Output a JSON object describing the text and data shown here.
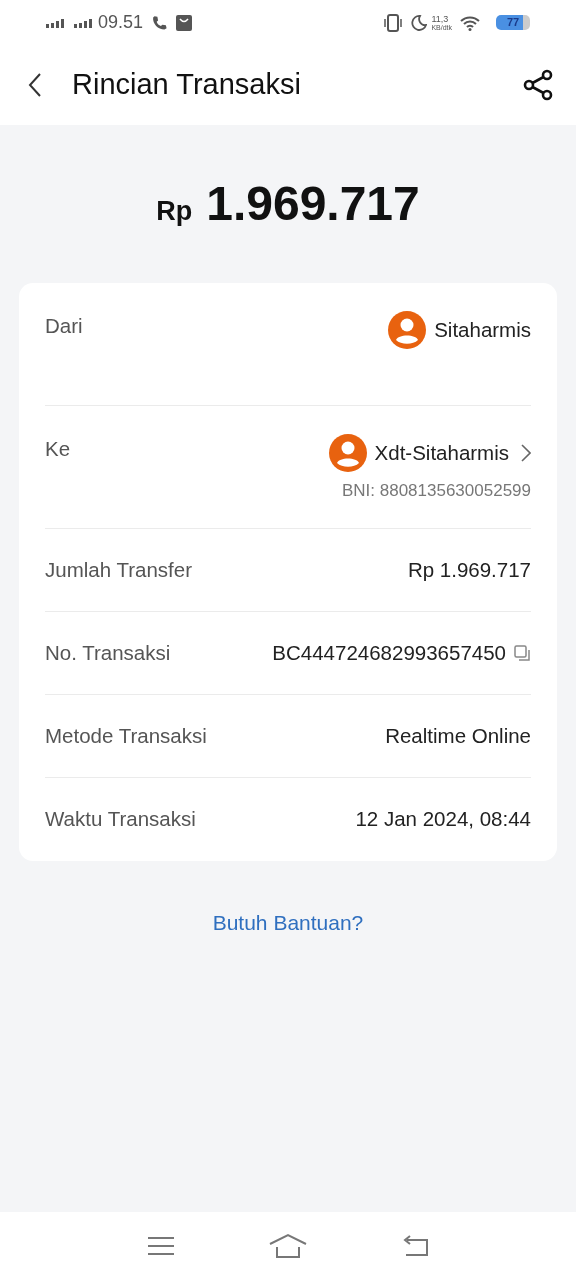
{
  "status_bar": {
    "time": "09.51",
    "speed_value": "11,3",
    "speed_unit": "KB/dtk",
    "battery": "77"
  },
  "header": {
    "title": "Rincian Transaksi"
  },
  "amount": {
    "currency": "Rp",
    "value": "1.969.717"
  },
  "details": [
    {
      "kind": "party",
      "label": "Dari",
      "name": "Sitaharmis"
    },
    {
      "kind": "party_link",
      "label": "Ke",
      "name": "Xdt-Sitaharmis",
      "account": "BNI: 8808135630052599"
    },
    {
      "kind": "text",
      "label": "Jumlah Transfer",
      "value": "Rp 1.969.717"
    },
    {
      "kind": "copy",
      "label": "No. Transaksi",
      "value": "BC444724682993657450"
    },
    {
      "kind": "text",
      "label": "Metode Transaksi",
      "value": "Realtime Online"
    },
    {
      "kind": "text",
      "label": "Waktu Transaksi",
      "value": "12 Jan 2024, 08:44"
    }
  ],
  "help_link": "Butuh Bantuan?"
}
